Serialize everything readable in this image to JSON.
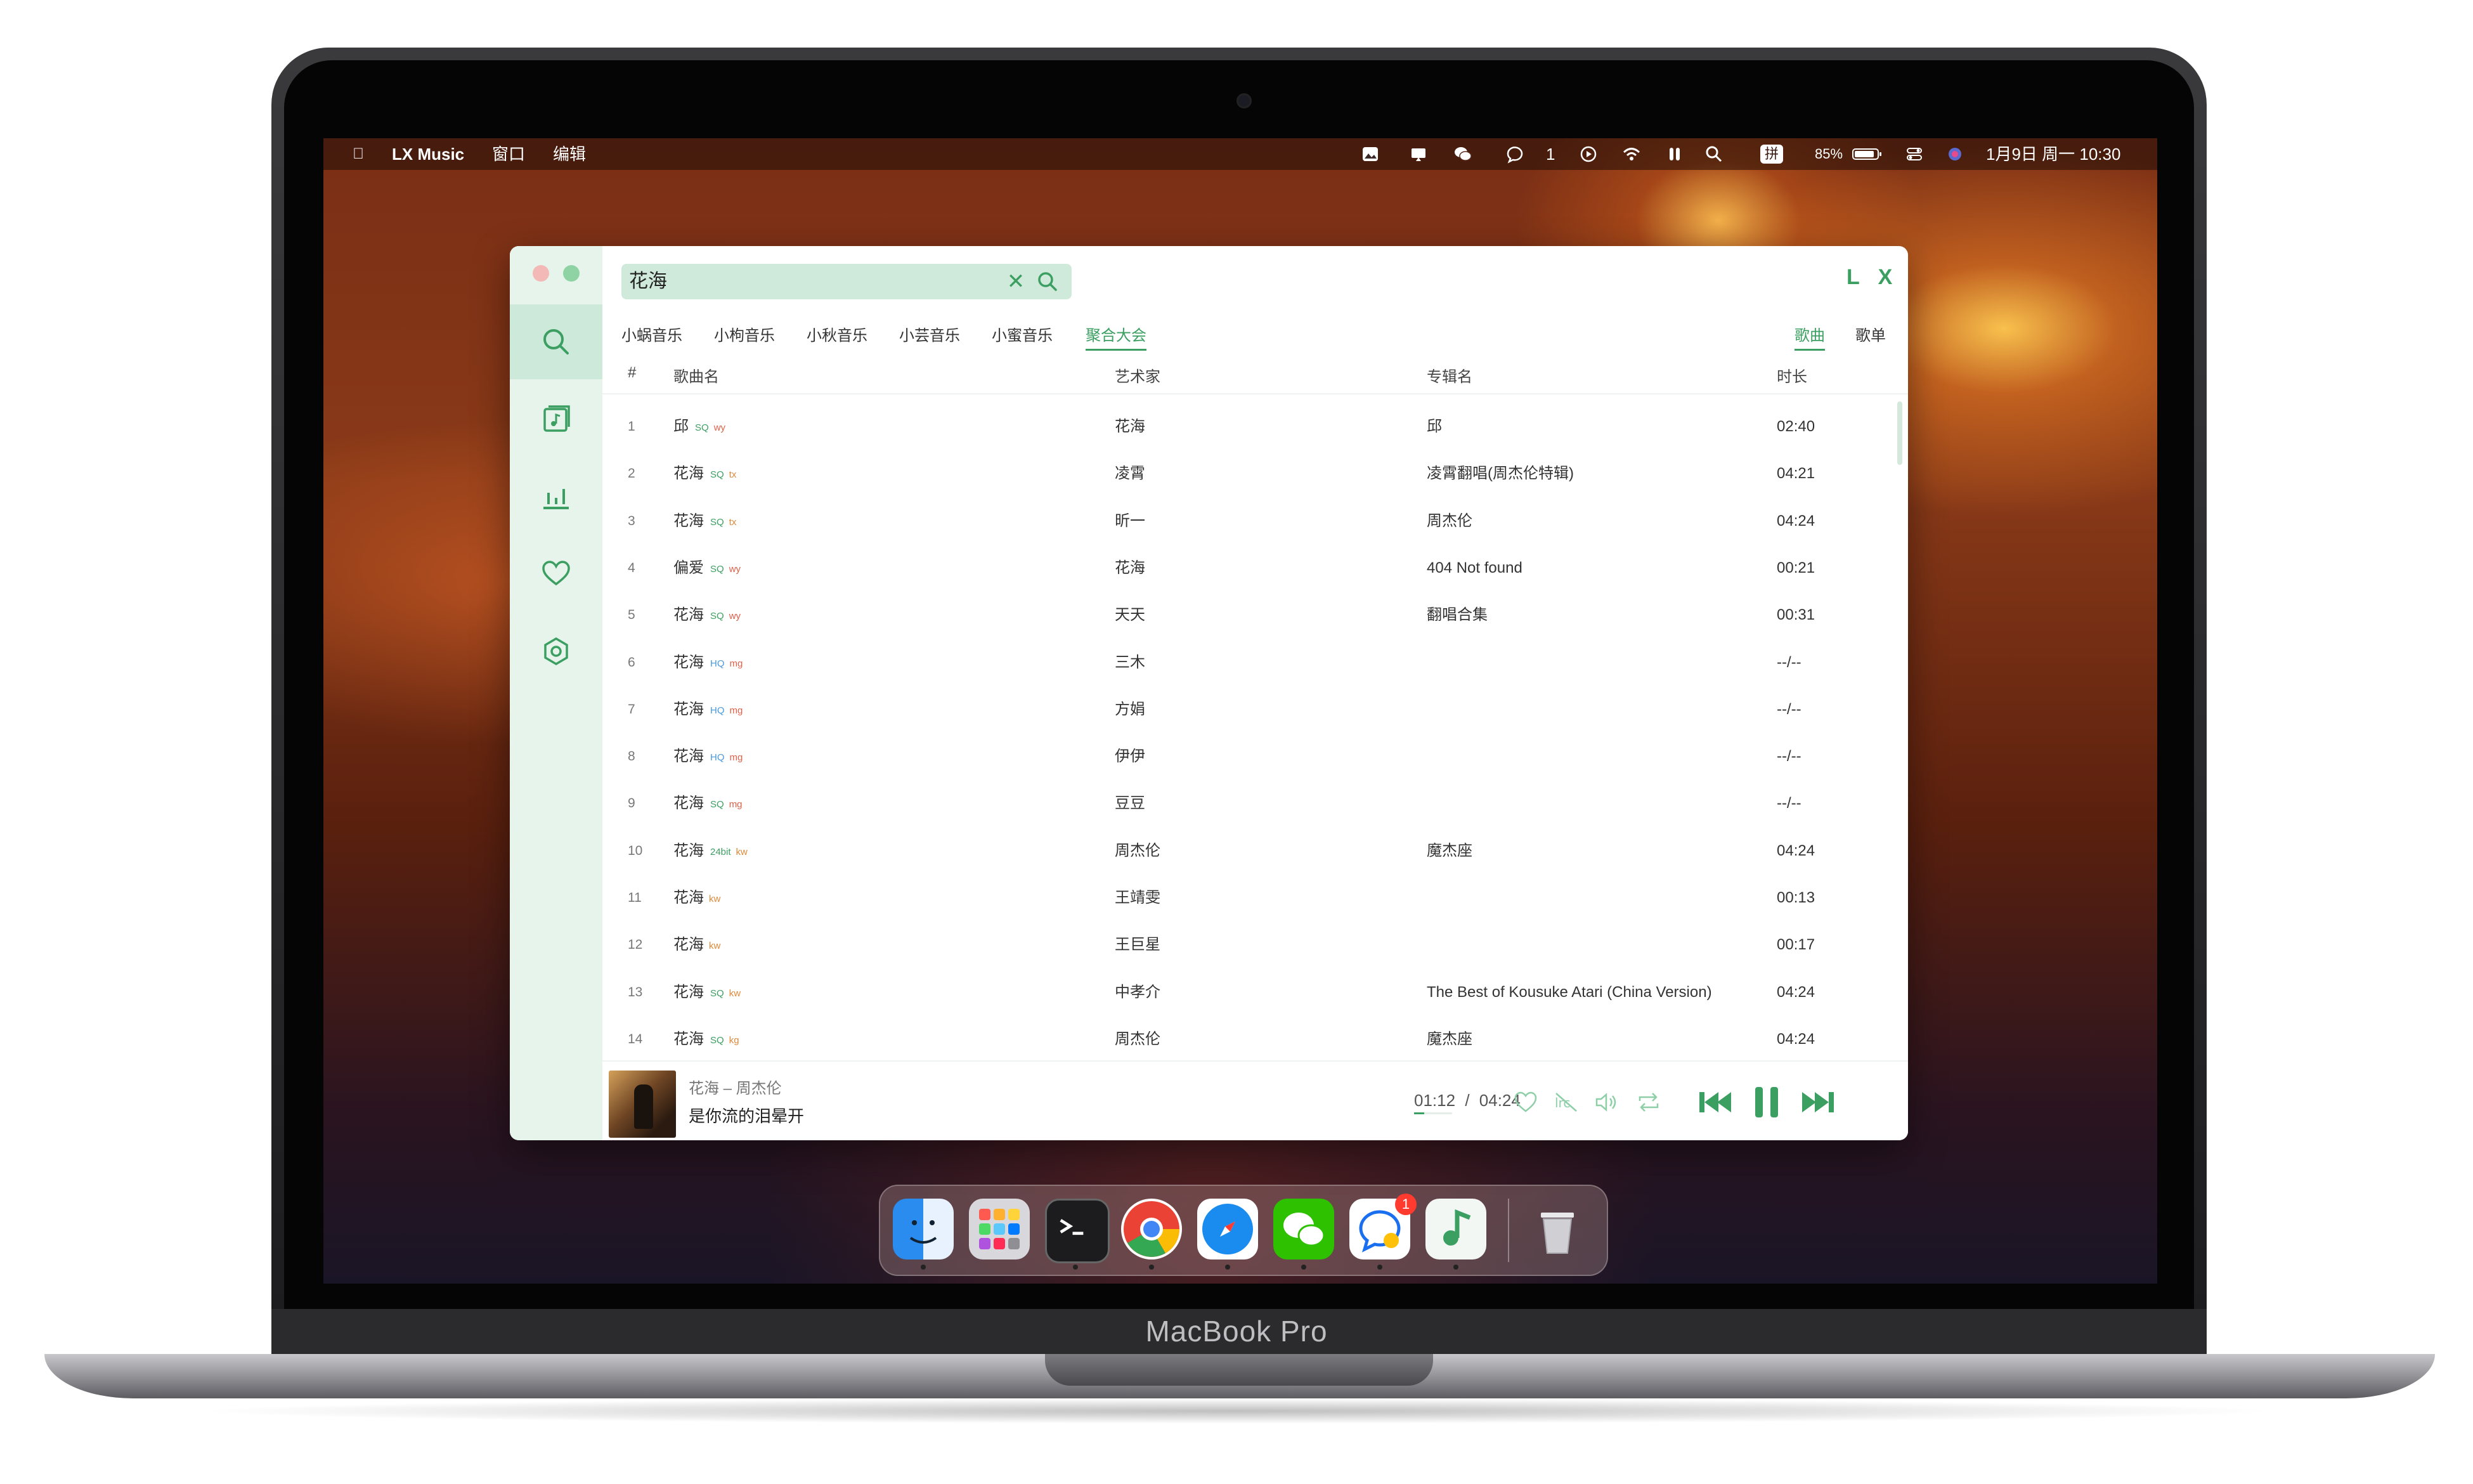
{
  "device": {
    "label": "MacBook Pro"
  },
  "menubar": {
    "apple_icon": "apple-icon",
    "app_name": "LX Music",
    "menus": [
      "窗口",
      "编辑"
    ],
    "chat_count": "1",
    "battery": "85%",
    "input_method": "拼",
    "datetime": "1月9日 周一  10:30"
  },
  "app": {
    "logo": "L X",
    "search": {
      "value": "花海",
      "clear": "✕"
    },
    "sources": [
      "小蜗音乐",
      "小枸音乐",
      "小秋音乐",
      "小芸音乐",
      "小蜜音乐",
      "聚合大会"
    ],
    "active_source": "聚合大会",
    "types": [
      "歌曲",
      "歌单"
    ],
    "active_type": "歌曲",
    "columns": {
      "num": "#",
      "name": "歌曲名",
      "artist": "艺术家",
      "album": "专辑名",
      "duration": "时长"
    },
    "songs": [
      {
        "num": "1",
        "name": "邱",
        "quality": "SQ",
        "source": "wy",
        "artist": "花海",
        "album": "邱",
        "duration": "02:40"
      },
      {
        "num": "2",
        "name": "花海",
        "quality": "SQ",
        "source": "tx",
        "artist": "凌霄",
        "album": "凌霄翻唱(周杰伦特辑)",
        "duration": "04:21"
      },
      {
        "num": "3",
        "name": "花海",
        "quality": "SQ",
        "source": "tx",
        "artist": "昕一",
        "album": "周杰伦",
        "duration": "04:24"
      },
      {
        "num": "4",
        "name": "偏爱",
        "quality": "SQ",
        "source": "wy",
        "artist": "花海",
        "album": "404 Not found",
        "duration": "00:21"
      },
      {
        "num": "5",
        "name": "花海",
        "quality": "SQ",
        "source": "wy",
        "artist": "天天",
        "album": "翻唱合集",
        "duration": "00:31"
      },
      {
        "num": "6",
        "name": "花海",
        "quality": "HQ",
        "source": "mg",
        "artist": "三木",
        "album": "",
        "duration": "--/--"
      },
      {
        "num": "7",
        "name": "花海",
        "quality": "HQ",
        "source": "mg",
        "artist": "方娟",
        "album": "",
        "duration": "--/--"
      },
      {
        "num": "8",
        "name": "花海",
        "quality": "HQ",
        "source": "mg",
        "artist": "伊伊",
        "album": "",
        "duration": "--/--"
      },
      {
        "num": "9",
        "name": "花海",
        "quality": "SQ",
        "source": "mg",
        "artist": "豆豆",
        "album": "",
        "duration": "--/--"
      },
      {
        "num": "10",
        "name": "花海",
        "quality": "24bit",
        "source": "kw",
        "artist": "周杰伦",
        "album": "魔杰座",
        "duration": "04:24"
      },
      {
        "num": "11",
        "name": "花海",
        "quality": "",
        "source": "kw",
        "artist": "王靖雯",
        "album": "",
        "duration": "00:13"
      },
      {
        "num": "12",
        "name": "花海",
        "quality": "",
        "source": "kw",
        "artist": "王巨星",
        "album": "",
        "duration": "00:17"
      },
      {
        "num": "13",
        "name": "花海",
        "quality": "SQ",
        "source": "kw",
        "artist": "中孝介",
        "album": "The Best of Kousuke Atari (China Version)",
        "duration": "04:24"
      },
      {
        "num": "14",
        "name": "花海",
        "quality": "SQ",
        "source": "kg",
        "artist": "周杰伦",
        "album": "魔杰座",
        "duration": "04:24"
      }
    ],
    "player": {
      "title": "花海 – 周杰伦",
      "lyric": "是你流的泪晕开",
      "current_time": "01:12",
      "separator": "/",
      "total_time": "04:24",
      "progress": 0.27
    }
  },
  "dock": {
    "apps": [
      "finder-icon",
      "launchpad-icon",
      "terminal-icon",
      "chrome-icon",
      "safari-icon",
      "wechat-icon",
      "chat-icon",
      "lx-music-icon",
      "trash-icon"
    ],
    "badge": "1"
  },
  "colors": {
    "accent": "#3c9f62",
    "sidebar": "#e6f4ec",
    "search_bg": "#cfe9da"
  }
}
